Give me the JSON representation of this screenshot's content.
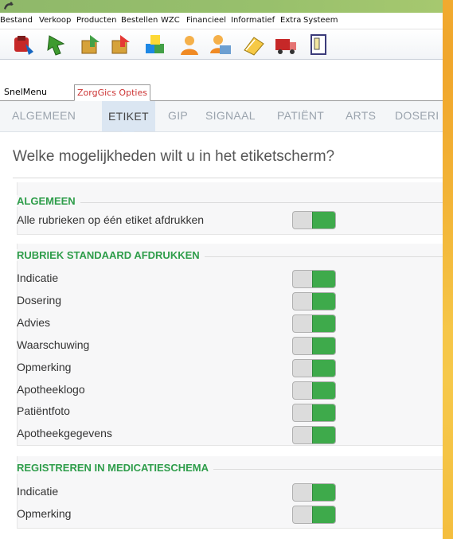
{
  "menu": [
    "Bestand",
    "Verkoop",
    "Producten",
    "Bestellen",
    "WZC",
    "Financieel",
    "Informatief",
    "Extra",
    "Systeem"
  ],
  "toolbar_icons": [
    "medicine-icon",
    "green-arrow-icon",
    "green-box-icon",
    "red-box-icon",
    "blocks-icon",
    "user-orange-icon",
    "user-folder-icon",
    "book-icon",
    "truck-icon",
    "doorstep-icon"
  ],
  "snel_tabs": [
    {
      "label": "SnelMenu",
      "active": false
    },
    {
      "label": "ZorgGics Opties",
      "active": true
    }
  ],
  "category_tabs": [
    "ALGEMEEN",
    "ETIKET",
    "GIP",
    "SIGNAAL",
    "PATIËNT",
    "ARTS",
    "DOSERI"
  ],
  "active_category": "ETIKET",
  "question": "Welke mogelijkheden wilt u in het etiketscherm?",
  "sections": [
    {
      "title": "ALGEMEEN",
      "rows": [
        {
          "label": "Alle rubrieken op één etiket afdrukken",
          "on": true
        }
      ]
    },
    {
      "title": "RUBRIEK STANDAARD AFDRUKKEN",
      "rows": [
        {
          "label": "Indicatie",
          "on": true
        },
        {
          "label": "Dosering",
          "on": true
        },
        {
          "label": "Advies",
          "on": true
        },
        {
          "label": "Waarschuwing",
          "on": true
        },
        {
          "label": "Opmerking",
          "on": true
        },
        {
          "label": "Apotheeklogo",
          "on": true
        },
        {
          "label": "Patiëntfoto",
          "on": true
        },
        {
          "label": "Apotheekgegevens",
          "on": true
        }
      ]
    },
    {
      "title": "REGISTREREN IN MEDICATIESCHEMA",
      "rows": [
        {
          "label": "Indicatie",
          "on": true
        },
        {
          "label": "Opmerking",
          "on": true
        }
      ]
    }
  ],
  "colors": {
    "accent_green": "#3eaa4b",
    "section_green": "#2e9d4a",
    "title_bar": "#98c06c"
  }
}
